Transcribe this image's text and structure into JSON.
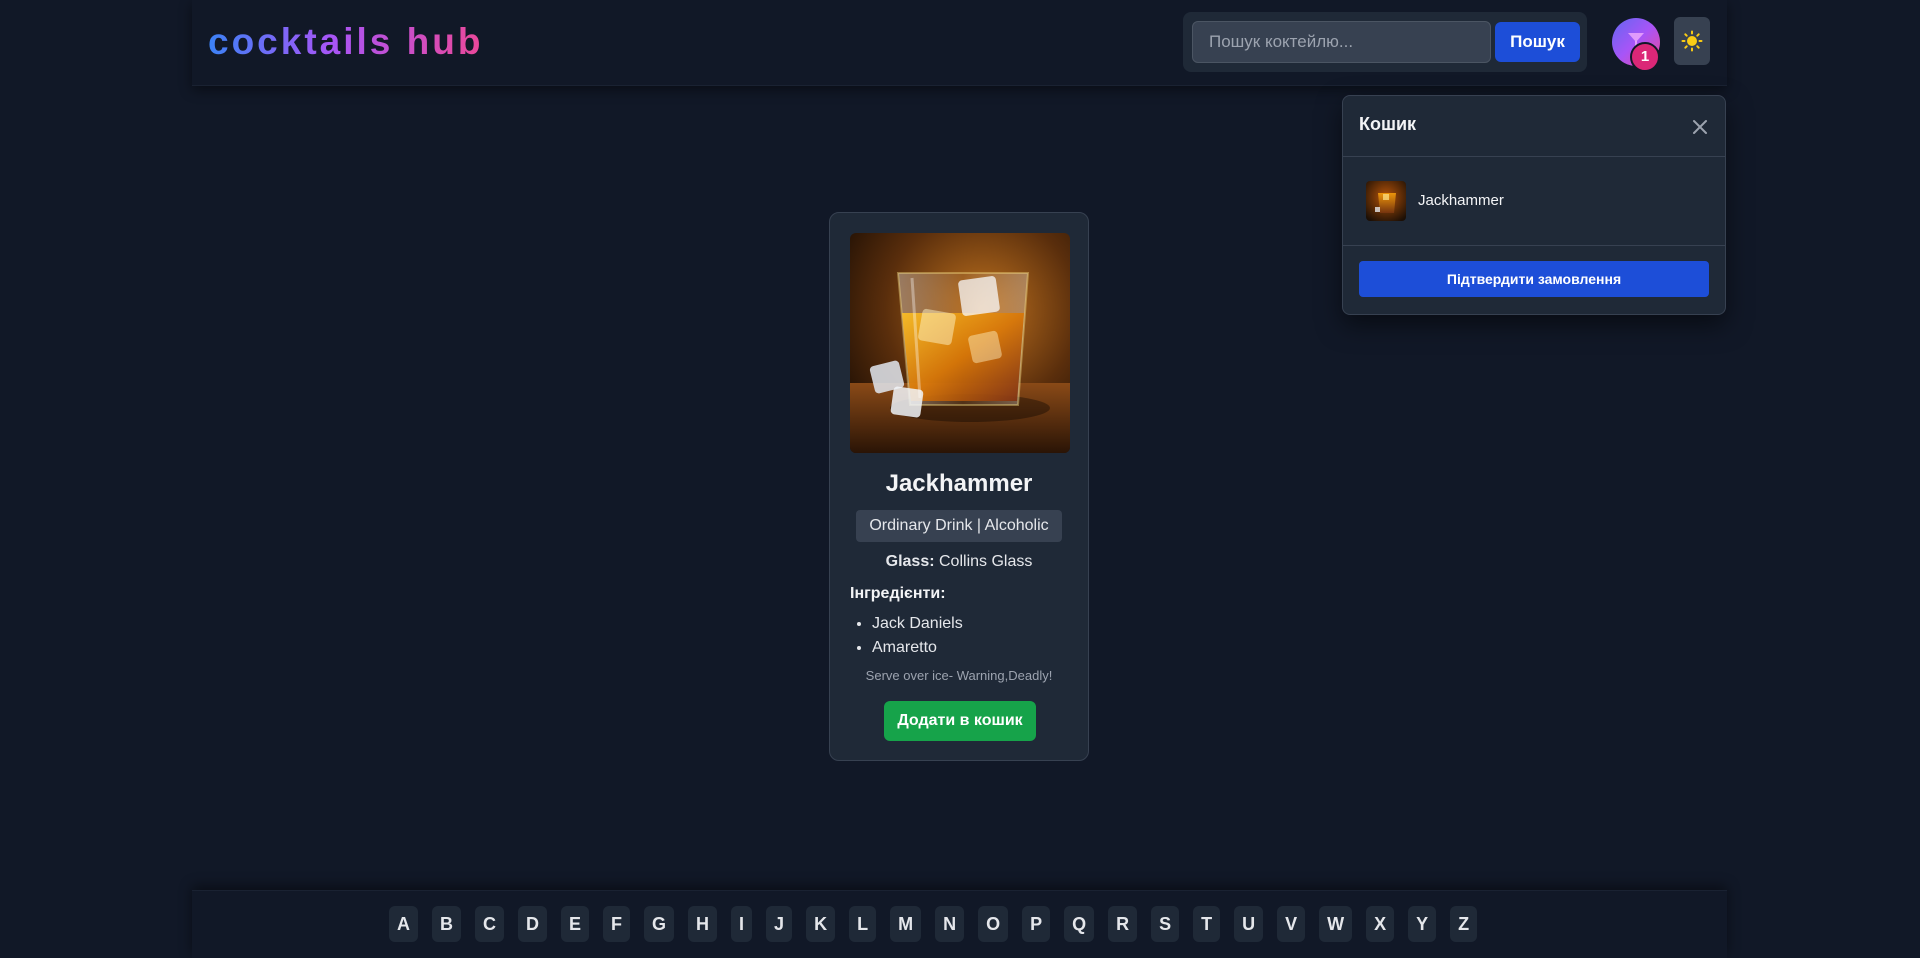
{
  "header": {
    "logo": "cocktails hub",
    "search": {
      "placeholder": "Пошук коктейлю...",
      "value": "",
      "button_label": "Пошук"
    },
    "cart_count": "1",
    "theme_icon": "sun-icon"
  },
  "cart": {
    "title": "Кошик",
    "items": [
      {
        "name": "Jackhammer"
      }
    ],
    "confirm_label": "Підтвердити замовлення"
  },
  "cocktail": {
    "name": "Jackhammer",
    "category": "Ordinary Drink | Alcoholic",
    "glass_label": "Glass:",
    "glass_value": "Collins Glass",
    "ingredients_title": "Інгредієнти:",
    "ingredients": [
      "Jack Daniels",
      "Amaretto"
    ],
    "instructions": "Serve over ice- Warning,Deadly!",
    "add_label": "Додати в кошик"
  },
  "alphabet": [
    "A",
    "B",
    "C",
    "D",
    "E",
    "F",
    "G",
    "H",
    "I",
    "J",
    "K",
    "L",
    "M",
    "N",
    "O",
    "P",
    "Q",
    "R",
    "S",
    "T",
    "U",
    "V",
    "W",
    "X",
    "Y",
    "Z"
  ],
  "colors": {
    "background": "#111827",
    "panel": "#1f2937",
    "primary": "#1d4ed8",
    "success": "#16a34a",
    "badge": "#db2777"
  }
}
